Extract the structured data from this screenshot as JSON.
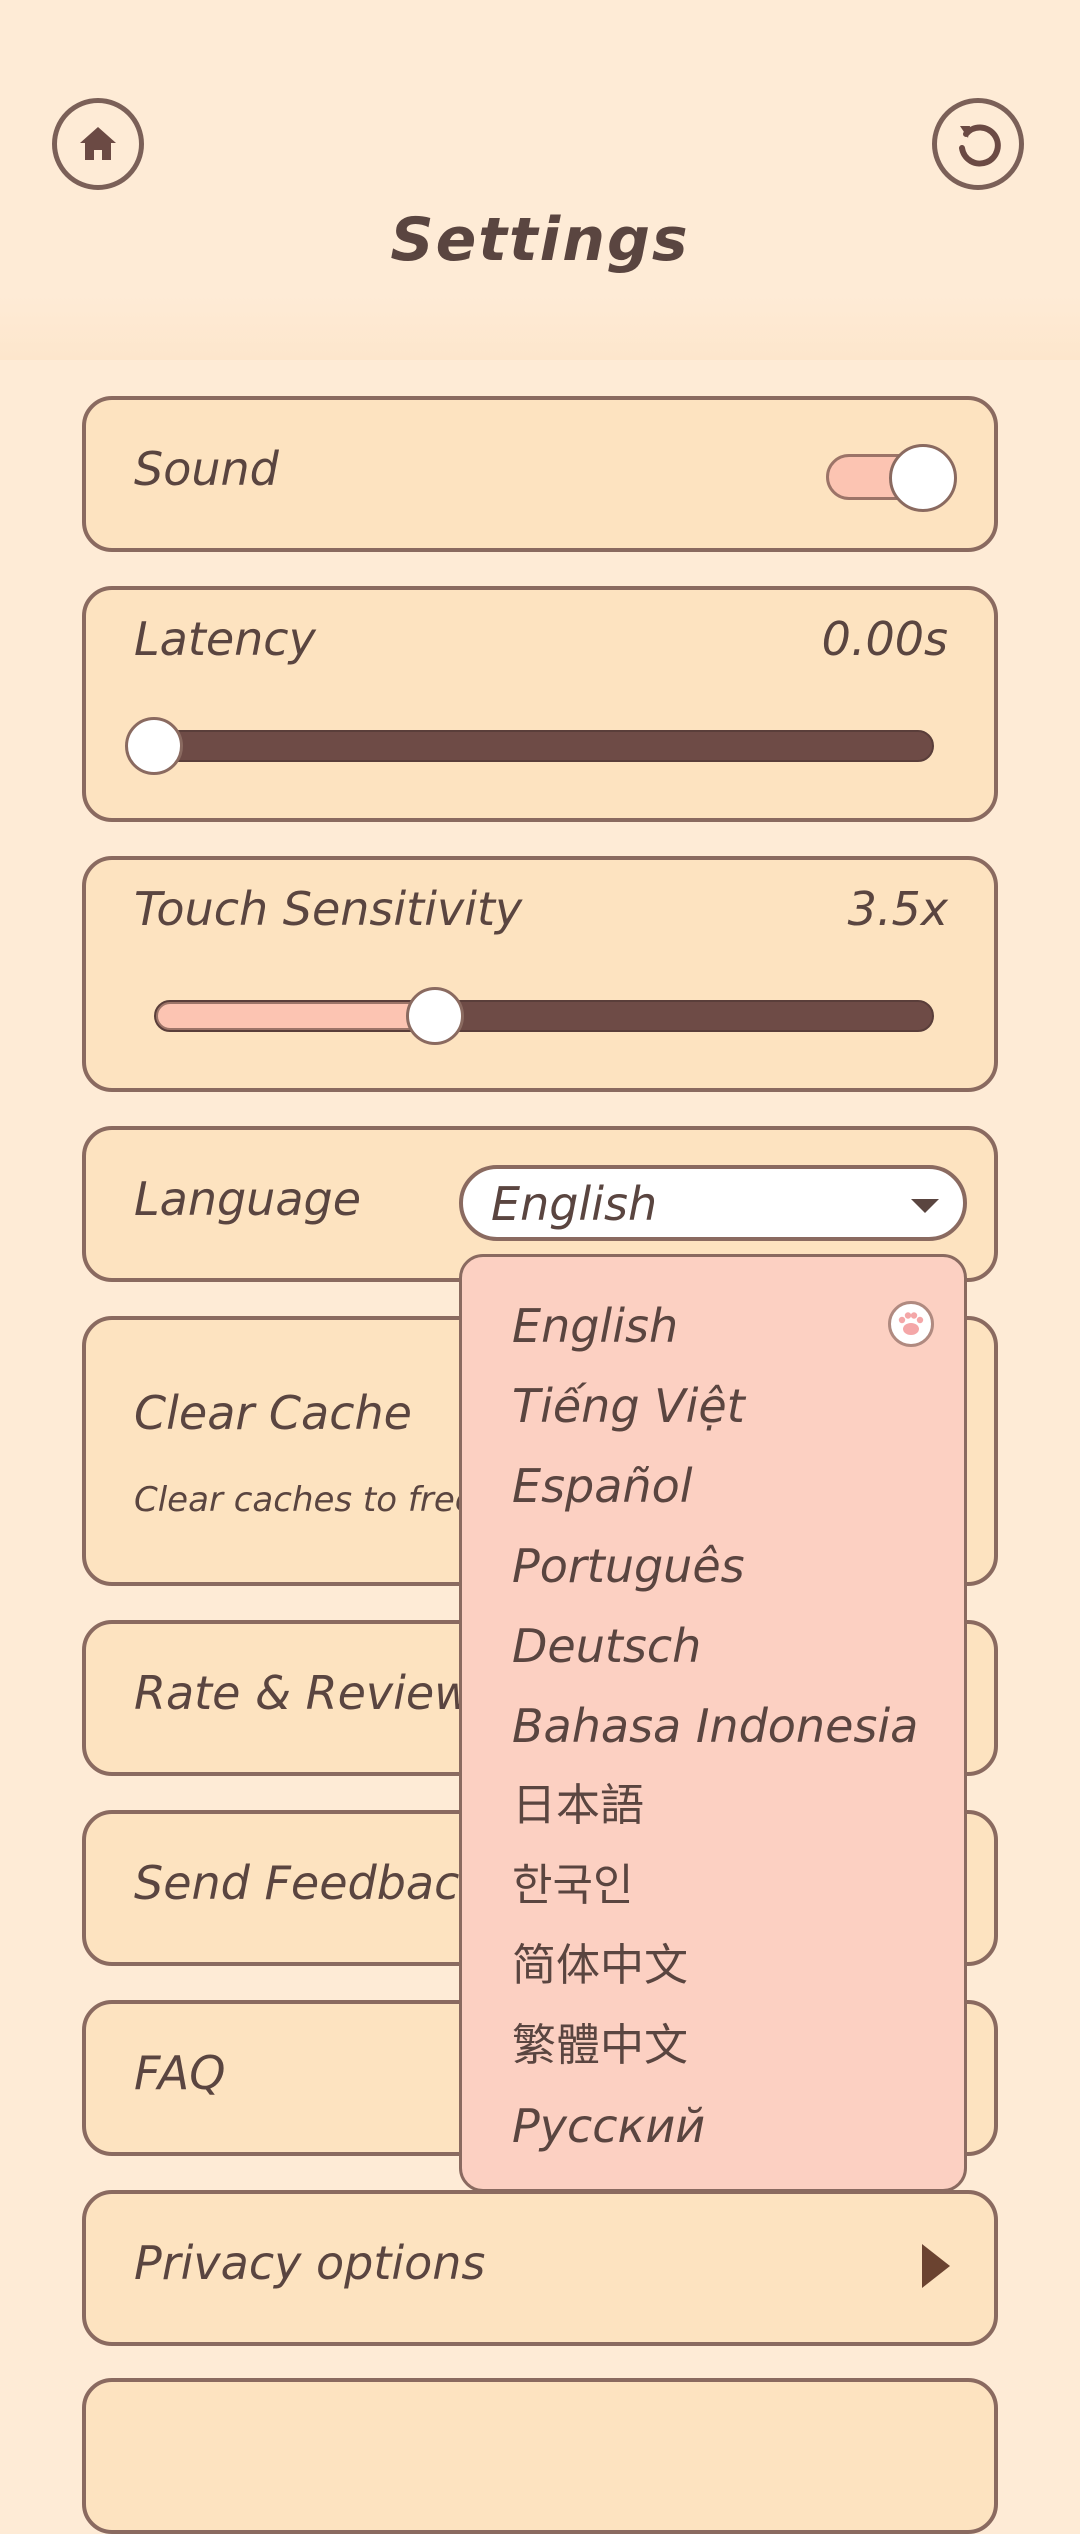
{
  "header": {
    "title": "Settings",
    "home_icon": "home-icon",
    "reset_icon": "refresh-icon"
  },
  "sound": {
    "label": "Sound",
    "enabled": true
  },
  "latency": {
    "label": "Latency",
    "value": "0.00s",
    "level": 0
  },
  "touch_sensitivity": {
    "label": "Touch Sensitivity",
    "value": "3.5x",
    "level": 0.36
  },
  "language": {
    "label": "Language",
    "selected": "English",
    "options": [
      "English",
      "Tiếng Việt",
      "Español",
      "Português",
      "Deutsch",
      "Bahasa Indonesia",
      "日本語",
      "한국인",
      "简体中文",
      "繁體中文",
      "Русский"
    ],
    "selected_icon": "paw-icon"
  },
  "clear_cache": {
    "label": "Clear Cache",
    "description": "Clear caches to free up"
  },
  "rate_review": {
    "label": "Rate & Review"
  },
  "send_feedback": {
    "label": "Send Feedback"
  },
  "faq": {
    "label": "FAQ"
  },
  "privacy": {
    "label": "Privacy options",
    "icon": "play-arrow-icon"
  },
  "colors": {
    "background": "#feebd6",
    "card": "#fde3c0",
    "border": "#8a6a60",
    "accent": "#fcc4b2",
    "track": "#6e4b46",
    "text": "#5a4540"
  }
}
